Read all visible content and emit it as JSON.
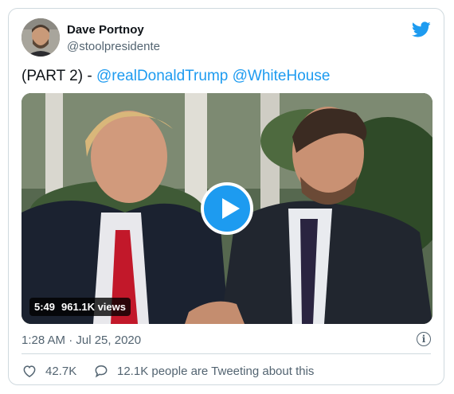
{
  "author": {
    "display_name": "Dave Portnoy",
    "handle": "@stoolpresidente"
  },
  "tweet": {
    "text_prefix": "(PART 2) - ",
    "mention_1": "@realDonaldTrump",
    "mention_2": "@WhiteHouse"
  },
  "video": {
    "duration": "5:49",
    "views": "961.1K views"
  },
  "meta": {
    "timestamp": "1:28 AM · Jul 25, 2020"
  },
  "actions": {
    "like_count": "42.7K",
    "reply_text": "12.1K people are Tweeting about this"
  },
  "colors": {
    "accent": "#1d9bf0",
    "muted": "#536471",
    "border": "#cfd9de"
  },
  "icons": [
    "twitter-bird-icon",
    "play-icon",
    "info-icon",
    "heart-icon",
    "speech-bubble-icon"
  ]
}
